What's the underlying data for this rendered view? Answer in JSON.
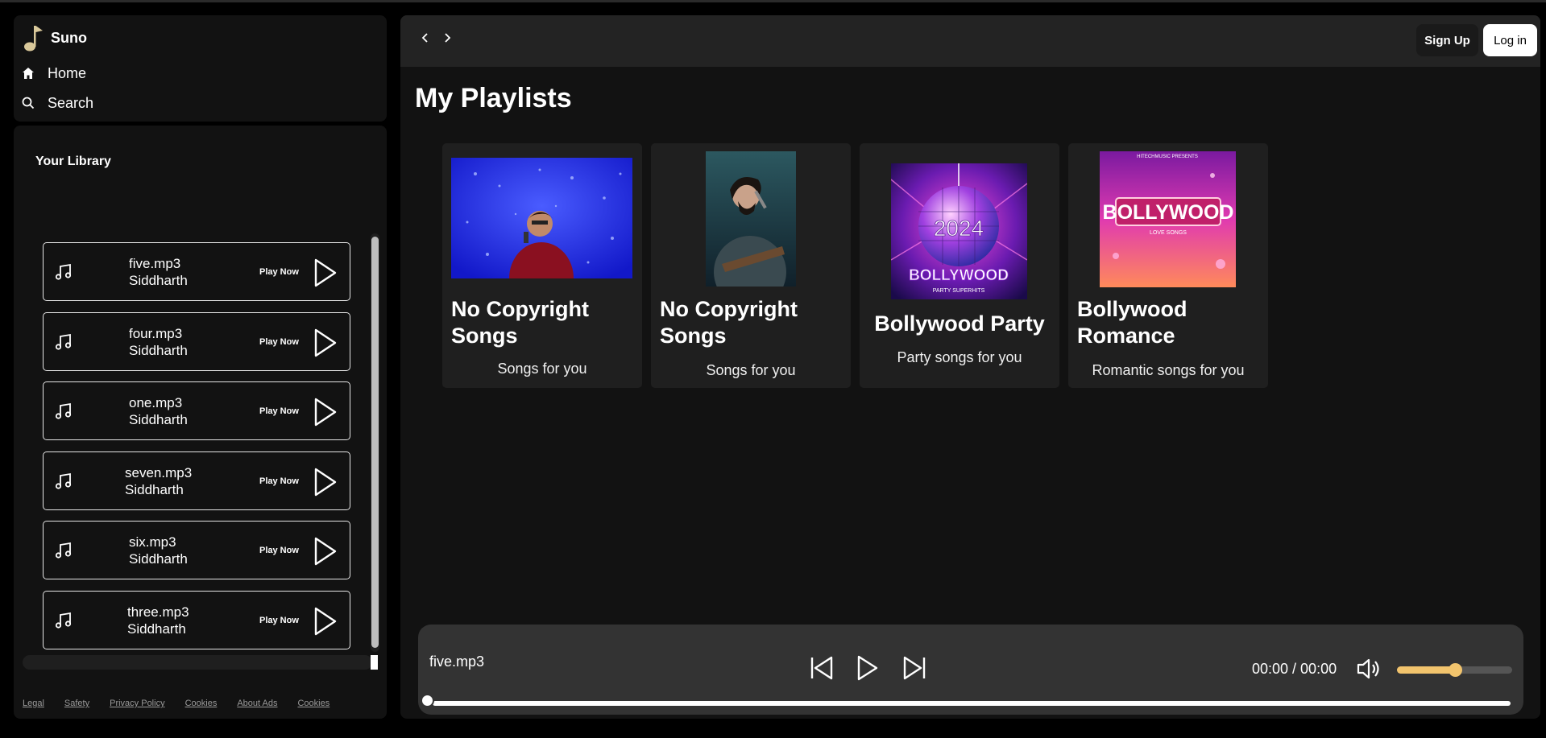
{
  "brand": {
    "name": "Suno"
  },
  "nav": {
    "home": "Home",
    "search": "Search"
  },
  "library": {
    "title": "Your Library",
    "play_label": "Play Now",
    "songs": [
      {
        "file": "five.mp3",
        "artist": "Siddharth"
      },
      {
        "file": "four.mp3",
        "artist": "Siddharth"
      },
      {
        "file": "one.mp3",
        "artist": "Siddharth"
      },
      {
        "file": "seven.mp3",
        "artist": "Siddharth"
      },
      {
        "file": "six.mp3",
        "artist": "Siddharth"
      },
      {
        "file": "three.mp3",
        "artist": "Siddharth"
      }
    ]
  },
  "footer": {
    "links": [
      "Legal",
      "Safety",
      "Privacy Policy",
      "Cookies",
      "About Ads",
      "Cookies"
    ]
  },
  "header": {
    "signup": "Sign Up",
    "login": "Log in"
  },
  "main": {
    "title": "My Playlists",
    "playlists": [
      {
        "title": "No Copyright Songs",
        "description": "Songs for you"
      },
      {
        "title": "No Copyright Songs",
        "description": "Songs for you"
      },
      {
        "title": "Bollywood Party",
        "description": "Party songs for you",
        "cover_text": {
          "year": "2024",
          "name": "BOLLYWOOD",
          "tag": "PARTY SUPERHITS"
        }
      },
      {
        "title": "Bollywood Romance",
        "description": "Romantic songs for you",
        "cover_text": {
          "top": "HITECHMUSIC PRESENTS",
          "name": "BOLLYWOOD",
          "tag": "LOVE SONGS"
        }
      }
    ]
  },
  "player": {
    "track": "five.mp3",
    "time": "00:00 / 00:00",
    "volume": 0.5,
    "progress": 0.0
  },
  "colors": {
    "accent": "#f2c46d",
    "panel": "#121212",
    "player": "#333333"
  }
}
